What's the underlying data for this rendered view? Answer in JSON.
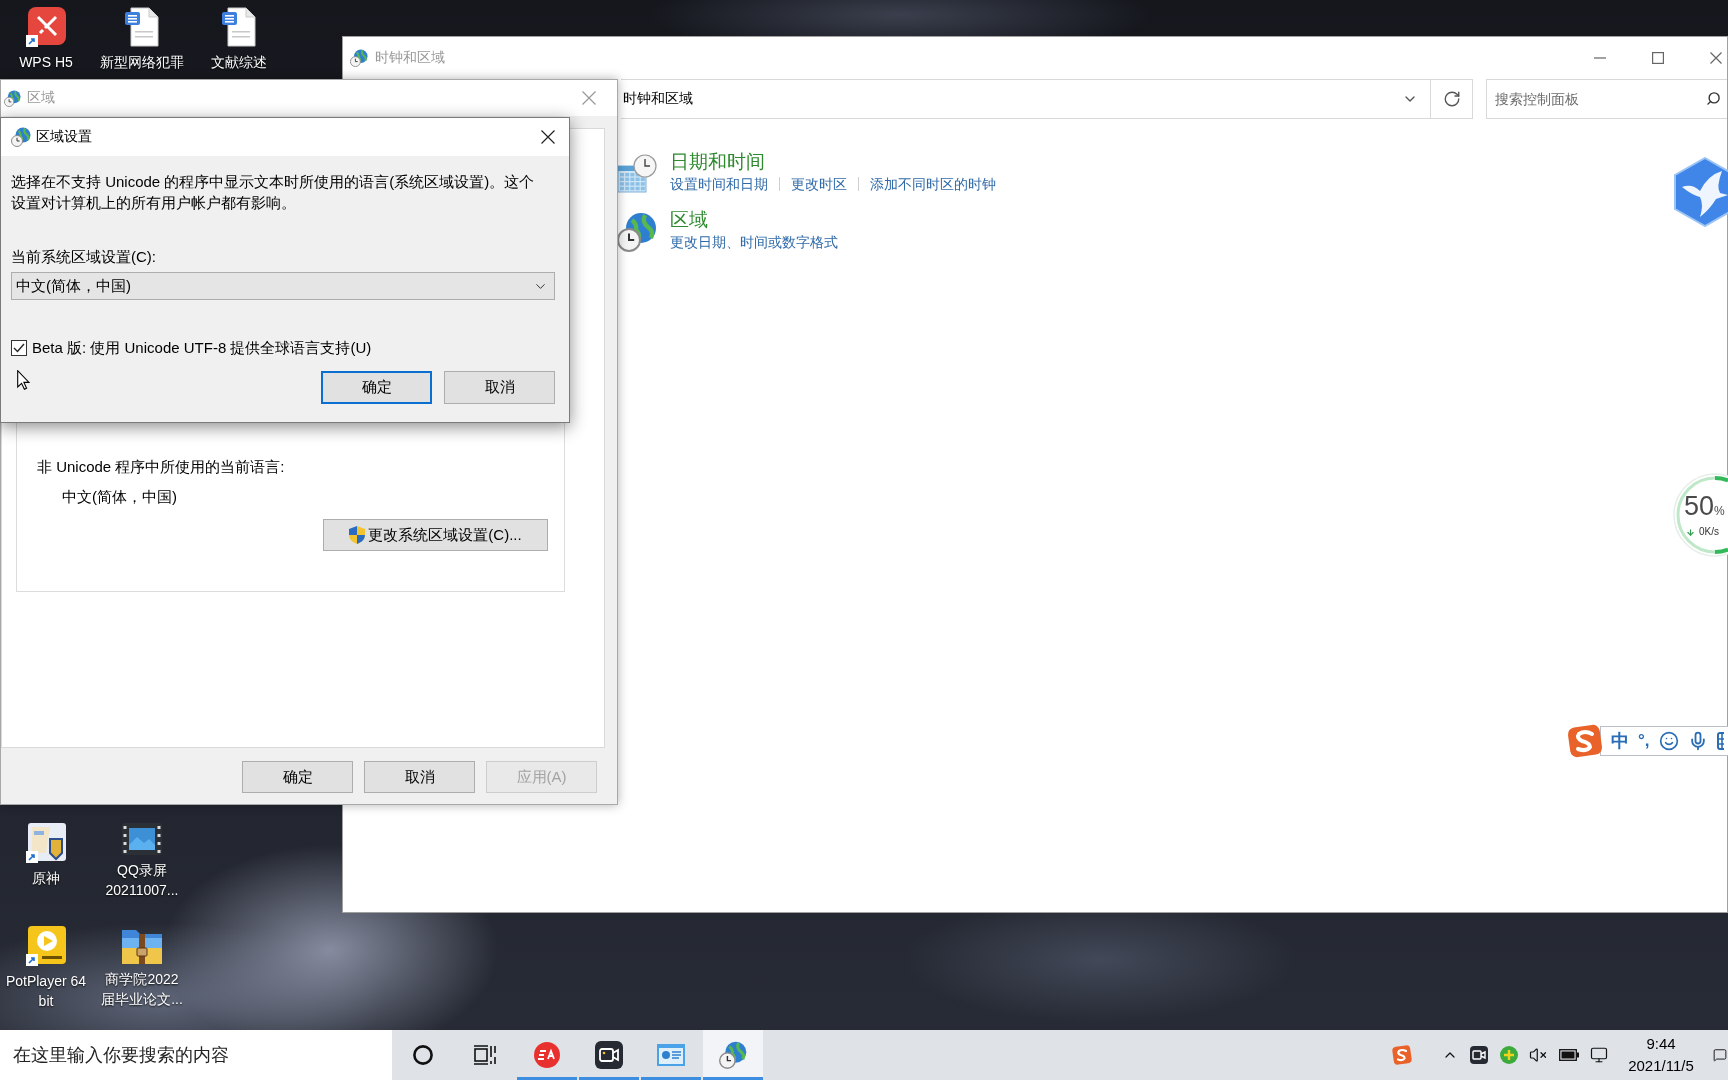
{
  "desktop_icons": [
    {
      "kind": "wps",
      "label": [
        "WPS H5"
      ]
    },
    {
      "kind": "document",
      "label": [
        "新型网络犯罪"
      ]
    },
    {
      "kind": "document",
      "label": [
        "文献综述"
      ]
    },
    {
      "kind": "game",
      "label": [
        "原神"
      ]
    },
    {
      "kind": "video",
      "label": [
        "QQ录屏",
        "20211007..."
      ]
    },
    {
      "kind": "player",
      "label": [
        "PotPlayer 64",
        "bit"
      ]
    },
    {
      "kind": "archive",
      "label": [
        "商学院2022",
        "届毕业论文..."
      ]
    }
  ],
  "control_panel": {
    "title": "时钟和区域",
    "breadcrumb": "时钟和区域",
    "search": {
      "placeholder": "搜索控制面板"
    },
    "categories": [
      {
        "kind": "date-time",
        "title": "日期和时间",
        "links": [
          "设置时间和日期",
          "更改时区",
          "添加不同时区的时钟"
        ]
      },
      {
        "kind": "region",
        "title": "区域",
        "links": [
          "更改日期、时间或数字格式"
        ]
      }
    ]
  },
  "region_window": {
    "title": "区域",
    "current_language_label": "非 Unicode 程序中所使用的当前语言:",
    "current_language": "中文(简体，中国)",
    "change_button": "更改系统区域设置(C)...",
    "buttons": [
      {
        "label": "确定",
        "disabled": false
      },
      {
        "label": "取消",
        "disabled": false
      },
      {
        "label": "应用(A)",
        "disabled": true
      }
    ]
  },
  "locale_dialog": {
    "title": "区域设置",
    "description": "选择在不支持 Unicode 的程序中显示文本时所使用的语言(系统区域设置)。这个设置对计算机上的所有用户帐户都有影响。",
    "locale_label": "当前系统区域设置(C):",
    "locale_value": "中文(简体，中国)",
    "utf8_option": {
      "label": "Beta 版: 使用 Unicode UTF-8 提供全球语言支持(U)",
      "checked": true
    },
    "buttons": [
      {
        "label": "确定",
        "default": true
      },
      {
        "label": "取消",
        "default": false
      }
    ]
  },
  "usage_ball": {
    "value": "50",
    "unit": "%",
    "speed": "0K/s"
  },
  "ime_toolbar": {
    "mode": "中",
    "punctuation": "°,"
  },
  "taskbar": {
    "search": {
      "placeholder": "在这里输入你要搜索的内容"
    },
    "apps": [
      {
        "kind": "assistant",
        "running": false,
        "selected": false
      },
      {
        "kind": "task-view",
        "running": false,
        "selected": false
      },
      {
        "kind": "game-launcher",
        "running": true,
        "selected": false
      },
      {
        "kind": "recorder",
        "running": true,
        "selected": false
      },
      {
        "kind": "control-panel",
        "running": true,
        "selected": false
      },
      {
        "kind": "region",
        "running": true,
        "selected": true
      }
    ],
    "clock": {
      "time": "9:44",
      "date": "2021/11/5"
    }
  }
}
